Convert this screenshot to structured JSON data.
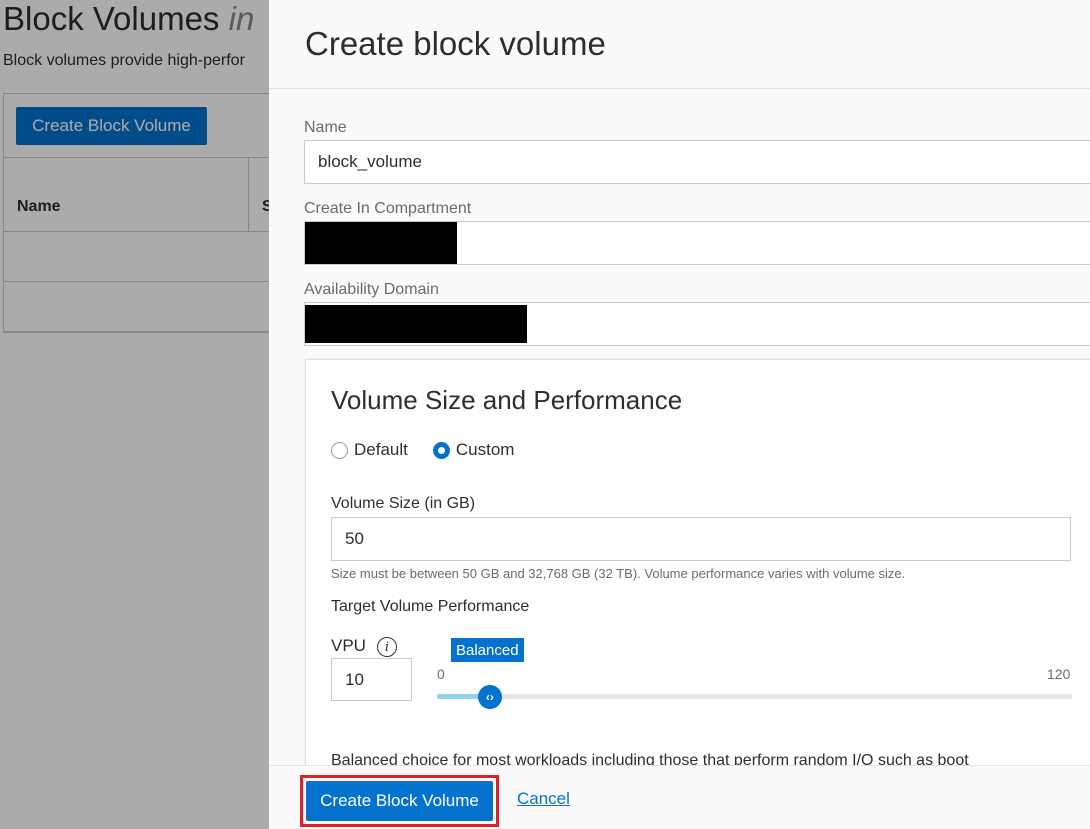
{
  "background": {
    "title": "Block Volumes",
    "title_suffix": "in",
    "description": "Block volumes provide high-perfor",
    "create_button_label": "Create Block Volume",
    "table_headers": [
      "Name",
      "S"
    ]
  },
  "drawer": {
    "title": "Create block volume",
    "fields": {
      "name": {
        "label": "Name",
        "value": "block_volume"
      },
      "compartment": {
        "label": "Create In Compartment",
        "value": ""
      },
      "availability_domain": {
        "label": "Availability Domain",
        "value": ""
      }
    },
    "size_section": {
      "title": "Volume Size and Performance",
      "options": [
        {
          "label": "Default",
          "checked": false
        },
        {
          "label": "Custom",
          "checked": true
        }
      ],
      "volume_size_label": "Volume Size (in GB)",
      "volume_size_value": "50",
      "volume_size_help": "Size must be between 50 GB and 32,768 GB (32 TB). Volume performance varies with volume size.",
      "target_performance_label": "Target Volume Performance",
      "vpu_label": "VPU",
      "vpu_value": "10",
      "slider": {
        "badge": "Balanced",
        "min": "0",
        "max": "120",
        "value": 10,
        "thumb_glyph": "‹›"
      },
      "performance_description": "Balanced choice for most workloads including those that perform random I/O such as boot"
    },
    "footer": {
      "primary_label": "Create Block Volume",
      "cancel_label": "Cancel"
    }
  },
  "colors": {
    "accent": "#0572ce",
    "highlight_border": "#e0202a",
    "slider_fill": "#8fd2f0"
  }
}
